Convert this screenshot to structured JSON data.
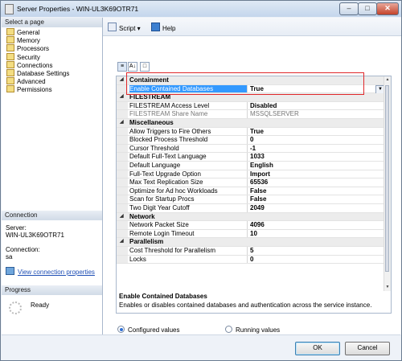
{
  "window": {
    "title": "Server Properties - WIN-UL3K69OTR71"
  },
  "left": {
    "select_page_header": "Select a page",
    "pages": [
      {
        "label": "General"
      },
      {
        "label": "Memory"
      },
      {
        "label": "Processors"
      },
      {
        "label": "Security"
      },
      {
        "label": "Connections"
      },
      {
        "label": "Database Settings"
      },
      {
        "label": "Advanced"
      },
      {
        "label": "Permissions"
      }
    ],
    "connection_header": "Connection",
    "server_label": "Server:",
    "server_value": "WIN-UL3K69OTR71",
    "connection_label": "Connection:",
    "connection_value": "sa",
    "view_connection_properties": "View connection properties",
    "progress_header": "Progress",
    "progress_status": "Ready"
  },
  "toolbar": {
    "script_label": "Script",
    "help_label": "Help"
  },
  "grid": {
    "rows": [
      {
        "kind": "cat",
        "name": "Containment"
      },
      {
        "kind": "prop",
        "name": "Enable Contained Databases",
        "value": "True",
        "selected": true
      },
      {
        "kind": "cat",
        "name": "FILESTREAM"
      },
      {
        "kind": "prop",
        "name": "FILESTREAM Access Level",
        "value": "Disabled"
      },
      {
        "kind": "prop",
        "name": "FILESTREAM Share Name",
        "value": "MSSQLSERVER",
        "readonly": true
      },
      {
        "kind": "cat",
        "name": "Miscellaneous"
      },
      {
        "kind": "prop",
        "name": "Allow Triggers to Fire Others",
        "value": "True"
      },
      {
        "kind": "prop",
        "name": "Blocked Process Threshold",
        "value": "0"
      },
      {
        "kind": "prop",
        "name": "Cursor Threshold",
        "value": "-1"
      },
      {
        "kind": "prop",
        "name": "Default Full-Text Language",
        "value": "1033"
      },
      {
        "kind": "prop",
        "name": "Default Language",
        "value": "English"
      },
      {
        "kind": "prop",
        "name": "Full-Text Upgrade Option",
        "value": "Import"
      },
      {
        "kind": "prop",
        "name": "Max Text Replication Size",
        "value": "65536"
      },
      {
        "kind": "prop",
        "name": "Optimize for Ad hoc Workloads",
        "value": "False"
      },
      {
        "kind": "prop",
        "name": "Scan for Startup Procs",
        "value": "False"
      },
      {
        "kind": "prop",
        "name": "Two Digit Year Cutoff",
        "value": "2049"
      },
      {
        "kind": "cat",
        "name": "Network"
      },
      {
        "kind": "prop",
        "name": "Network Packet Size",
        "value": "4096"
      },
      {
        "kind": "prop",
        "name": "Remote Login Timeout",
        "value": "10"
      },
      {
        "kind": "cat",
        "name": "Parallelism"
      },
      {
        "kind": "prop",
        "name": "Cost Threshold for Parallelism",
        "value": "5"
      },
      {
        "kind": "prop",
        "name": "Locks",
        "value": "0"
      }
    ]
  },
  "description": {
    "title": "Enable Contained Databases",
    "text": "Enables or disables contained databases and authentication across the service instance."
  },
  "options": {
    "configured": "Configured values",
    "running": "Running values",
    "selected": "configured"
  },
  "buttons": {
    "ok": "OK",
    "cancel": "Cancel"
  }
}
